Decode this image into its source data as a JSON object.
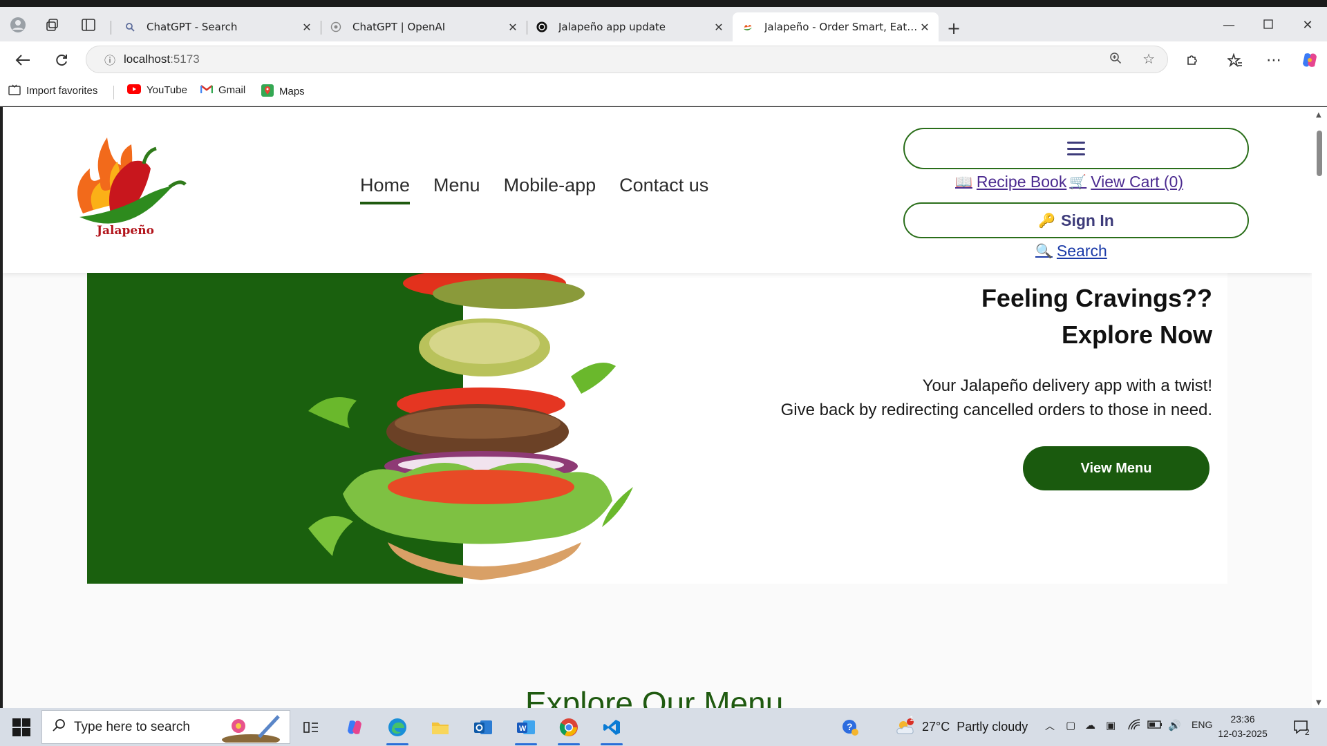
{
  "browser": {
    "tabs": [
      {
        "title": "ChatGPT - Search",
        "favicon": "search-icon",
        "active": false
      },
      {
        "title": "ChatGPT | OpenAI",
        "favicon": "openai-icon",
        "active": false
      },
      {
        "title": "Jalapeño app update",
        "favicon": "chatgpt-icon",
        "active": false
      },
      {
        "title": "Jalapeño - Order Smart, Eat Healthy",
        "favicon": "jalapeno-icon",
        "active": true
      }
    ],
    "address": {
      "host": "localhost",
      "port": ":5173"
    },
    "bookmarks": [
      {
        "label": "Import favorites",
        "icon": "import-icon"
      },
      {
        "label": "YouTube",
        "icon": "youtube-icon"
      },
      {
        "label": "Gmail",
        "icon": "gmail-icon"
      },
      {
        "label": "Maps",
        "icon": "maps-icon"
      }
    ]
  },
  "site": {
    "logo_text": "Jalapeño",
    "nav": [
      {
        "label": "Home",
        "active": true
      },
      {
        "label": "Menu",
        "active": false
      },
      {
        "label": "Mobile-app",
        "active": false
      },
      {
        "label": "Contact us",
        "active": false
      }
    ],
    "header_links": {
      "recipe_book": "Recipe Book",
      "view_cart": "View Cart (0)",
      "sign_in": "Sign In",
      "search": "Search"
    },
    "hero": {
      "title_line1": "Feeling Cravings??",
      "title_line2": "Explore Now",
      "sub_line1": "Your Jalapeño delivery app with a twist!",
      "sub_line2": "Give back by redirecting cancelled orders to those in need.",
      "cta": "View Menu"
    },
    "section_heading": "Explore Our Menu",
    "colors": {
      "brand_green": "#1a600e",
      "link_purple": "#4b2a8f",
      "link_blue": "#1a3aa8"
    }
  },
  "taskbar": {
    "search_placeholder": "Type here to search",
    "weather": "27°C  Partly cloudy",
    "language": "ENG",
    "time": "23:36",
    "date": "12-03-2025",
    "weather_badge": "1",
    "notification_count": "2"
  }
}
